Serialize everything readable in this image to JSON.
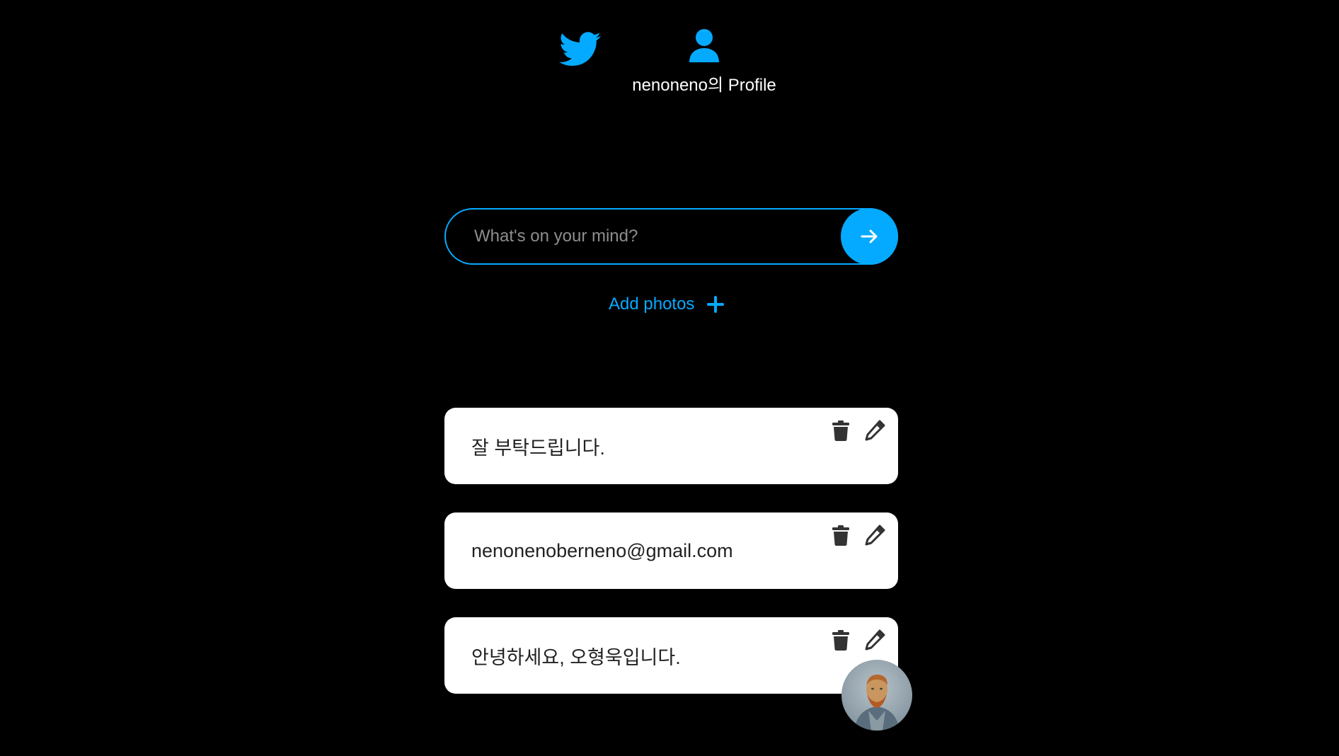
{
  "nav": {
    "home_icon": "twitter-bird-icon",
    "profile_icon": "user-icon",
    "profile_label": "nenoneno의 Profile"
  },
  "composer": {
    "placeholder": "What's on your mind?",
    "value": "",
    "submit_icon": "arrow-right-icon"
  },
  "add_photos": {
    "label": "Add photos",
    "icon": "plus-icon"
  },
  "tweets": [
    {
      "text": "잘 부탁드립니다.",
      "delete_icon": "trash-icon",
      "edit_icon": "pencil-icon",
      "has_photo": false
    },
    {
      "text": "nenonenoberneno@gmail.com",
      "delete_icon": "trash-icon",
      "edit_icon": "pencil-icon",
      "has_photo": false
    },
    {
      "text": "안녕하세요, 오형욱입니다.",
      "delete_icon": "trash-icon",
      "edit_icon": "pencil-icon",
      "has_photo": true
    }
  ],
  "colors": {
    "background": "#000000",
    "accent": "#04aaff",
    "card": "#ffffff",
    "card_text": "#222222",
    "icon_dark": "#333333"
  }
}
